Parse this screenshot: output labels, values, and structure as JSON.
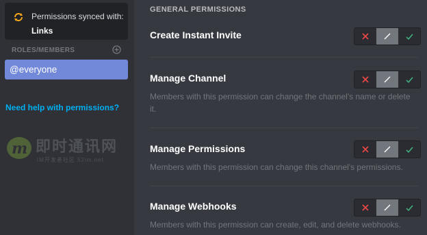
{
  "sidebar": {
    "sync_text": "Permissions synced with:",
    "sync_name": "Links",
    "roles_header": "ROLES/MEMBERS",
    "roles": [
      {
        "label": "@everyone",
        "selected": true
      }
    ],
    "help_link": "Need help with permissions?"
  },
  "watermark": {
    "title": "即时通讯网",
    "subtitle": "IM开发者社区 52im.net"
  },
  "main": {
    "section_title": "GENERAL PERMISSIONS",
    "permissions": [
      {
        "name": "Create Instant Invite",
        "description": "",
        "state": "neutral"
      },
      {
        "name": "Manage Channel",
        "description": "Members with this permission can change the channel's name or delete it.",
        "state": "neutral"
      },
      {
        "name": "Manage Permissions",
        "description": "Members with this permission can change this channel's permissions.",
        "state": "neutral"
      },
      {
        "name": "Manage Webhooks",
        "description": "Members with this permission can create, edit, and delete webhooks.",
        "state": "neutral"
      }
    ]
  },
  "colors": {
    "background": "#36393f",
    "sidebar": "#2f3136",
    "selected_role": "#7289da",
    "link": "#00b0f4",
    "deny": "#f04747",
    "allow": "#43b581",
    "neutral_selected": "#72767d",
    "sync_icon": "#faa61a"
  },
  "icons": {
    "sync": "sync-icon",
    "add": "add-circle-icon",
    "deny": "x-icon",
    "neutral": "slash-icon",
    "allow": "check-icon"
  }
}
